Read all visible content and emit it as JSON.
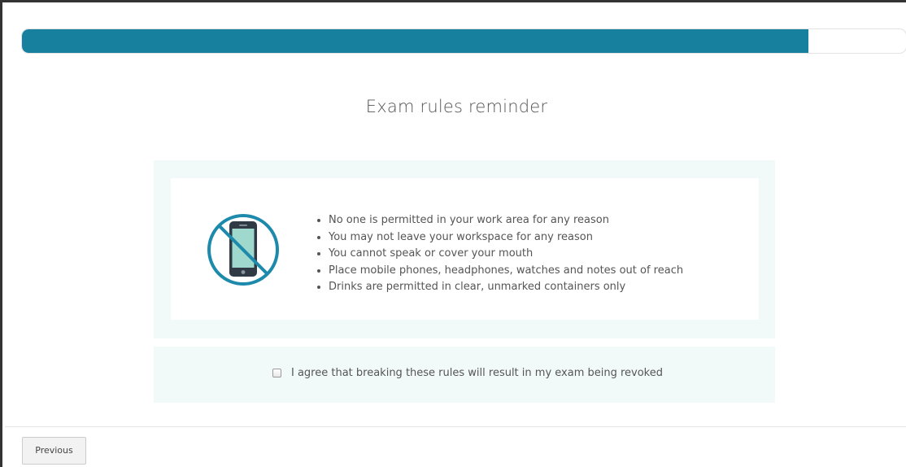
{
  "progress": {
    "value_percent": 89,
    "fill_color": "#18809f"
  },
  "page": {
    "title": "Exam rules reminder"
  },
  "rules": {
    "icon": "no-mobile-phone-icon",
    "icon_color": "#1e8aab",
    "items": [
      "No one is permitted in your work area for any reason",
      "You may not leave your workspace for any reason",
      "You cannot speak or cover your mouth",
      "Place mobile phones, headphones, watches and notes out of reach",
      "Drinks are permitted in clear, unmarked containers only"
    ]
  },
  "agreement": {
    "checked": false,
    "label": "I agree that breaking these rules will result in my exam being revoked"
  },
  "footer": {
    "previous_label": "Previous"
  },
  "colors": {
    "panel_background": "#f2f9f9",
    "phone_screen": "#9fd8cc",
    "phone_body": "#2f3a44"
  }
}
